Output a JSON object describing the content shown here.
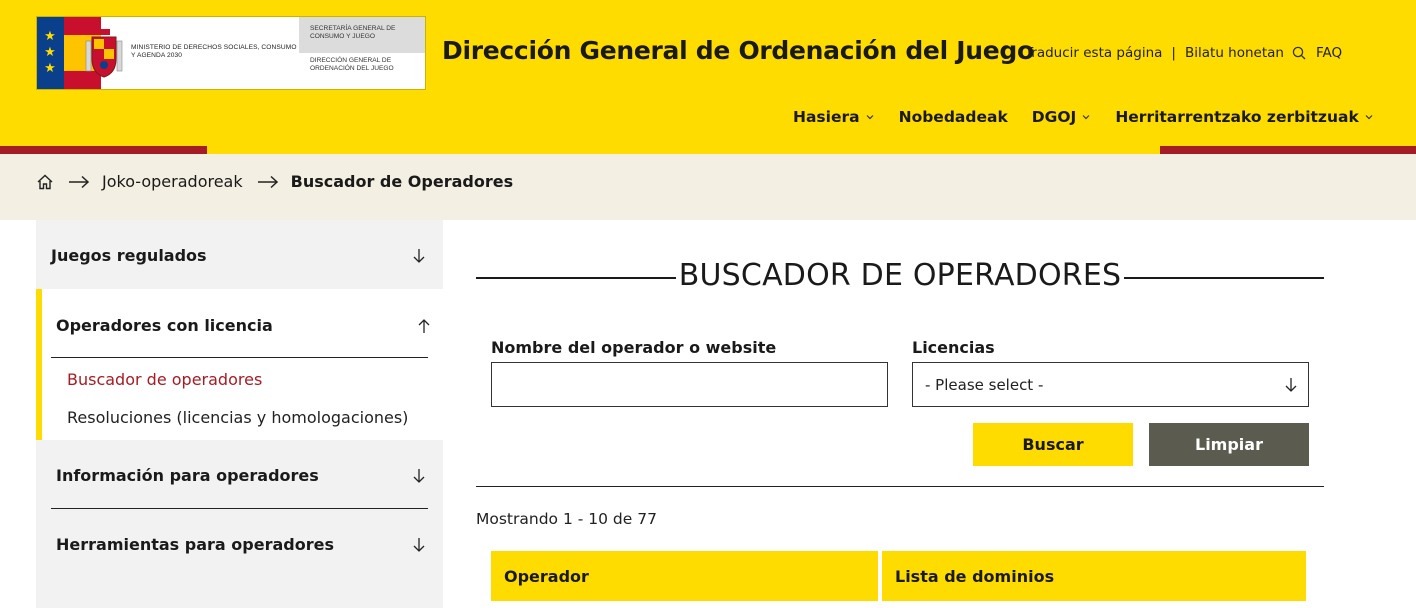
{
  "header": {
    "logo": {
      "ministry": "Ministerio de Derechos Sociales, Consumo y Agenda 2030",
      "secretariat": "Secretaría General de Consumo y Juego",
      "directorate": "Dirección General de Ordenación del Juego"
    },
    "site_title": "Dirección General de Ordenación del Juego",
    "top_links": {
      "translate": "Traducir esta página",
      "separator": "|",
      "search": "Bilatu honetan",
      "faq": "FAQ"
    },
    "nav": [
      {
        "label": "Hasiera",
        "has_dropdown": true
      },
      {
        "label": "Nobedadeak",
        "has_dropdown": false
      },
      {
        "label": "DGOJ",
        "has_dropdown": true
      },
      {
        "label": "Herritarrentzako zerbitzuak",
        "has_dropdown": true
      }
    ],
    "colors": {
      "brand_yellow": "#ffdc00",
      "brand_red": "#a51c24"
    }
  },
  "breadcrumb": {
    "items": [
      "Joko-operadoreak",
      "Buscador de Operadores"
    ]
  },
  "sidebar": {
    "items": [
      {
        "label": "Juegos regulados",
        "expanded": false
      },
      {
        "label": "Operadores con licencia",
        "expanded": true,
        "children": [
          {
            "label": "Buscador de operadores",
            "active": true
          },
          {
            "label": "Resoluciones (licencias y homologaciones)",
            "active": false
          }
        ]
      },
      {
        "label": "Información para operadores",
        "expanded": false
      },
      {
        "label": "Herramientas para operadores",
        "expanded": false
      }
    ]
  },
  "main": {
    "title": "BUSCADOR DE OPERADORES",
    "form": {
      "operator_label": "Nombre del operador o website",
      "operator_value": "",
      "license_label": "Licencias",
      "license_selected": "- Please select -",
      "search_button": "Buscar",
      "clear_button": "Limpiar"
    },
    "results_count": "Mostrando 1 - 10 de 77",
    "table": {
      "columns": [
        "Operador",
        "Lista de dominios"
      ]
    }
  }
}
